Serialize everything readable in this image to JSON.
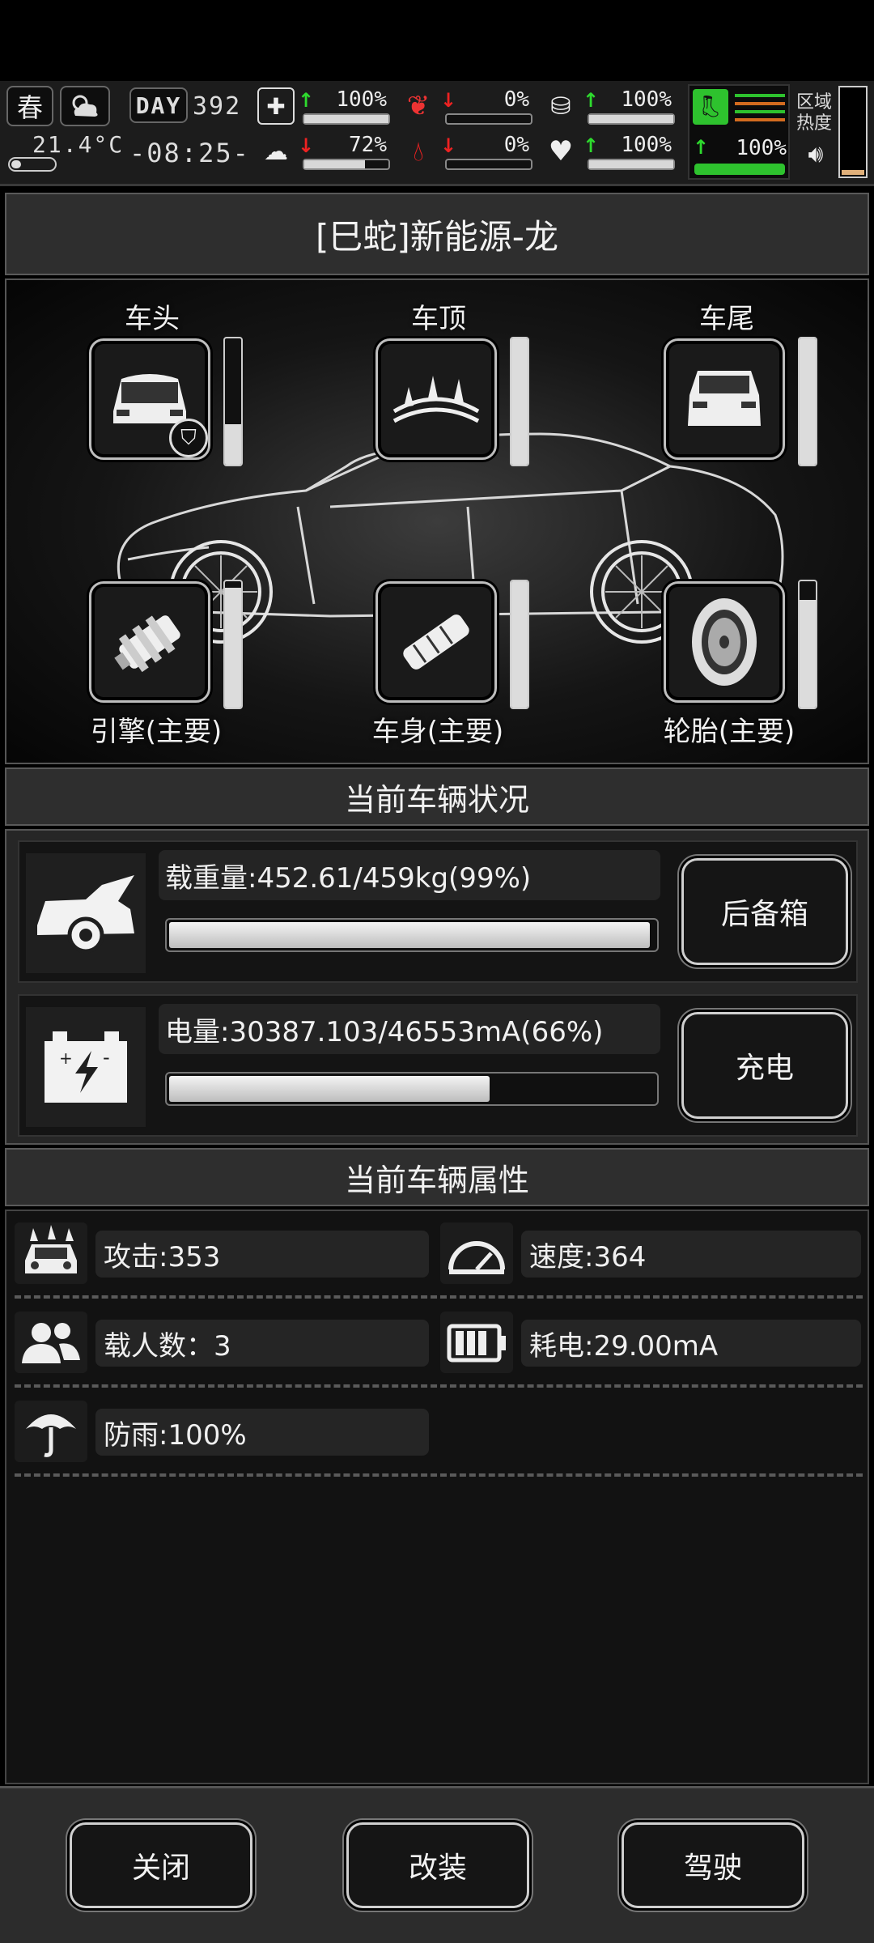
{
  "hud": {
    "season": "春",
    "temperature": "21.4°C",
    "day_label": "DAY",
    "day": "392",
    "time": "-08:25-",
    "stats": [
      {
        "icon": "medkit-icon",
        "trend": "up",
        "value": "100%",
        "fill": 1.0
      },
      {
        "icon": "stomach-icon",
        "trend": "down",
        "value": "0%",
        "fill": 0.0
      },
      {
        "icon": "water-icon",
        "trend": "up",
        "value": "100%",
        "fill": 1.0
      },
      {
        "icon": "brain-icon",
        "trend": "down",
        "value": "72%",
        "fill": 0.72
      },
      {
        "icon": "blood-drop-icon",
        "trend": "down",
        "value": "0%",
        "fill": 0.0
      },
      {
        "icon": "heart-icon",
        "trend": "up",
        "value": "100%",
        "fill": 1.0
      }
    ],
    "stamina": {
      "trend": "up",
      "value": "100%",
      "fill": 1.0
    },
    "region_heat_label": "区域热度",
    "region_heat_fill": 0.05
  },
  "vehicle": {
    "title": "[巳蛇]新能源-龙",
    "slots_top": [
      {
        "label": "车头",
        "durability": 0.32
      },
      {
        "label": "车顶",
        "durability": 1.0
      },
      {
        "label": "车尾",
        "durability": 1.0
      }
    ],
    "slots_bottom": [
      {
        "label": "引擎(主要)",
        "durability": 0.95
      },
      {
        "label": "车身(主要)",
        "durability": 1.0
      },
      {
        "label": "轮胎(主要)",
        "durability": 0.85
      }
    ]
  },
  "status": {
    "header": "当前车辆状况",
    "load_text": "载重量:452.61/459kg(99%)",
    "load_fill": 0.99,
    "trunk_button": "后备箱",
    "power_text": "电量:30387.103/46553mA(66%)",
    "power_fill": 0.66,
    "charge_button": "充电"
  },
  "attributes": {
    "header": "当前车辆属性",
    "attack": "攻击:353",
    "speed": "速度:364",
    "passengers": "载人数：3",
    "consumption": "耗电:29.00mA",
    "rainproof": "防雨:100%"
  },
  "footer": {
    "close": "关闭",
    "modify": "改装",
    "drive": "驾驶"
  }
}
